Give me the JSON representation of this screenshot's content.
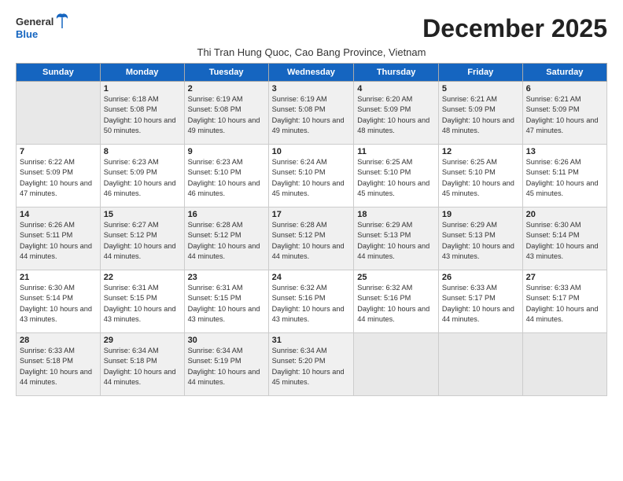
{
  "header": {
    "logo_line1": "General",
    "logo_line2": "Blue",
    "month_title": "December 2025",
    "subtitle": "Thi Tran Hung Quoc, Cao Bang Province, Vietnam"
  },
  "days_of_week": [
    "Sunday",
    "Monday",
    "Tuesday",
    "Wednesday",
    "Thursday",
    "Friday",
    "Saturday"
  ],
  "weeks": [
    [
      {
        "day": "",
        "empty": true
      },
      {
        "day": "1",
        "sunrise": "6:18 AM",
        "sunset": "5:08 PM",
        "daylight": "10 hours and 50 minutes."
      },
      {
        "day": "2",
        "sunrise": "6:19 AM",
        "sunset": "5:08 PM",
        "daylight": "10 hours and 49 minutes."
      },
      {
        "day": "3",
        "sunrise": "6:19 AM",
        "sunset": "5:08 PM",
        "daylight": "10 hours and 49 minutes."
      },
      {
        "day": "4",
        "sunrise": "6:20 AM",
        "sunset": "5:09 PM",
        "daylight": "10 hours and 48 minutes."
      },
      {
        "day": "5",
        "sunrise": "6:21 AM",
        "sunset": "5:09 PM",
        "daylight": "10 hours and 48 minutes."
      },
      {
        "day": "6",
        "sunrise": "6:21 AM",
        "sunset": "5:09 PM",
        "daylight": "10 hours and 47 minutes."
      }
    ],
    [
      {
        "day": "7",
        "sunrise": "6:22 AM",
        "sunset": "5:09 PM",
        "daylight": "10 hours and 47 minutes."
      },
      {
        "day": "8",
        "sunrise": "6:23 AM",
        "sunset": "5:09 PM",
        "daylight": "10 hours and 46 minutes."
      },
      {
        "day": "9",
        "sunrise": "6:23 AM",
        "sunset": "5:10 PM",
        "daylight": "10 hours and 46 minutes."
      },
      {
        "day": "10",
        "sunrise": "6:24 AM",
        "sunset": "5:10 PM",
        "daylight": "10 hours and 45 minutes."
      },
      {
        "day": "11",
        "sunrise": "6:25 AM",
        "sunset": "5:10 PM",
        "daylight": "10 hours and 45 minutes."
      },
      {
        "day": "12",
        "sunrise": "6:25 AM",
        "sunset": "5:10 PM",
        "daylight": "10 hours and 45 minutes."
      },
      {
        "day": "13",
        "sunrise": "6:26 AM",
        "sunset": "5:11 PM",
        "daylight": "10 hours and 45 minutes."
      }
    ],
    [
      {
        "day": "14",
        "sunrise": "6:26 AM",
        "sunset": "5:11 PM",
        "daylight": "10 hours and 44 minutes."
      },
      {
        "day": "15",
        "sunrise": "6:27 AM",
        "sunset": "5:12 PM",
        "daylight": "10 hours and 44 minutes."
      },
      {
        "day": "16",
        "sunrise": "6:28 AM",
        "sunset": "5:12 PM",
        "daylight": "10 hours and 44 minutes."
      },
      {
        "day": "17",
        "sunrise": "6:28 AM",
        "sunset": "5:12 PM",
        "daylight": "10 hours and 44 minutes."
      },
      {
        "day": "18",
        "sunrise": "6:29 AM",
        "sunset": "5:13 PM",
        "daylight": "10 hours and 44 minutes."
      },
      {
        "day": "19",
        "sunrise": "6:29 AM",
        "sunset": "5:13 PM",
        "daylight": "10 hours and 43 minutes."
      },
      {
        "day": "20",
        "sunrise": "6:30 AM",
        "sunset": "5:14 PM",
        "daylight": "10 hours and 43 minutes."
      }
    ],
    [
      {
        "day": "21",
        "sunrise": "6:30 AM",
        "sunset": "5:14 PM",
        "daylight": "10 hours and 43 minutes."
      },
      {
        "day": "22",
        "sunrise": "6:31 AM",
        "sunset": "5:15 PM",
        "daylight": "10 hours and 43 minutes."
      },
      {
        "day": "23",
        "sunrise": "6:31 AM",
        "sunset": "5:15 PM",
        "daylight": "10 hours and 43 minutes."
      },
      {
        "day": "24",
        "sunrise": "6:32 AM",
        "sunset": "5:16 PM",
        "daylight": "10 hours and 43 minutes."
      },
      {
        "day": "25",
        "sunrise": "6:32 AM",
        "sunset": "5:16 PM",
        "daylight": "10 hours and 44 minutes."
      },
      {
        "day": "26",
        "sunrise": "6:33 AM",
        "sunset": "5:17 PM",
        "daylight": "10 hours and 44 minutes."
      },
      {
        "day": "27",
        "sunrise": "6:33 AM",
        "sunset": "5:17 PM",
        "daylight": "10 hours and 44 minutes."
      }
    ],
    [
      {
        "day": "28",
        "sunrise": "6:33 AM",
        "sunset": "5:18 PM",
        "daylight": "10 hours and 44 minutes."
      },
      {
        "day": "29",
        "sunrise": "6:34 AM",
        "sunset": "5:18 PM",
        "daylight": "10 hours and 44 minutes."
      },
      {
        "day": "30",
        "sunrise": "6:34 AM",
        "sunset": "5:19 PM",
        "daylight": "10 hours and 44 minutes."
      },
      {
        "day": "31",
        "sunrise": "6:34 AM",
        "sunset": "5:20 PM",
        "daylight": "10 hours and 45 minutes."
      },
      {
        "day": "",
        "empty": true
      },
      {
        "day": "",
        "empty": true
      },
      {
        "day": "",
        "empty": true
      }
    ]
  ]
}
